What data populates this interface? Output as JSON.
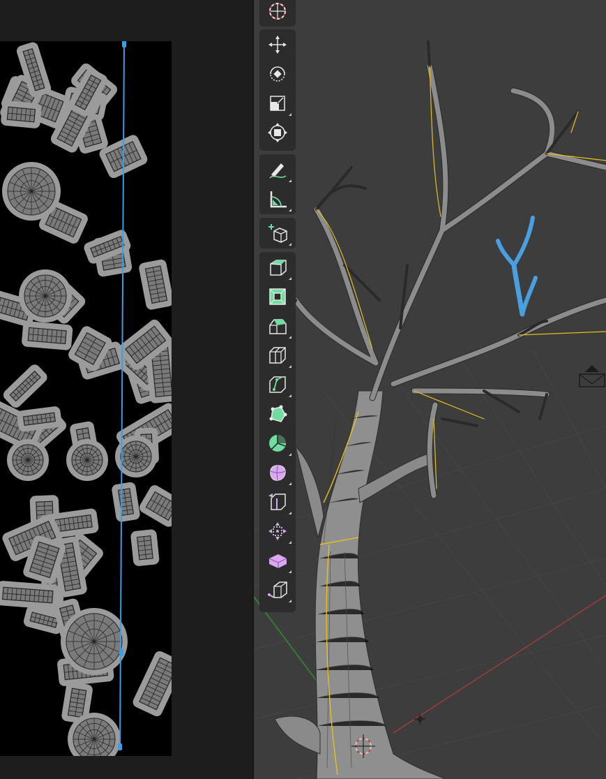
{
  "uv_editor": {
    "canvas_color": "#000000",
    "island_fill": "#7a7a7a",
    "island_edge": "#232323",
    "selected_edge_color": "#3a9ee6"
  },
  "viewport": {
    "background": "#3d3d3d",
    "mesh_color": "#8c8c8c",
    "seam_color": "#e6c11c",
    "selected_color": "#4a9fe0",
    "x_axis_color": "#b43c3c",
    "y_axis_color": "#2f8f2f"
  },
  "toolbar": {
    "groups": [
      {
        "tools": [
          {
            "icon": "cursor-icon"
          }
        ]
      },
      {
        "tools": [
          {
            "icon": "move-icon"
          },
          {
            "icon": "rotate-icon"
          },
          {
            "icon": "scale-icon"
          },
          {
            "icon": "transform-icon"
          }
        ]
      },
      {
        "tools": [
          {
            "icon": "annotate-icon"
          },
          {
            "icon": "measure-icon"
          }
        ]
      },
      {
        "tools": [
          {
            "icon": "add-cube-icon"
          }
        ]
      },
      {
        "tools": [
          {
            "icon": "extrude-region-icon"
          },
          {
            "icon": "inset-faces-icon"
          },
          {
            "icon": "bevel-icon"
          },
          {
            "icon": "loop-cut-icon"
          },
          {
            "icon": "knife-icon"
          },
          {
            "icon": "poly-build-icon"
          },
          {
            "icon": "spin-icon"
          },
          {
            "icon": "smooth-icon"
          },
          {
            "icon": "edge-slide-icon"
          },
          {
            "icon": "shrink-fatten-icon"
          },
          {
            "icon": "shear-icon"
          },
          {
            "icon": "rip-region-icon"
          }
        ]
      }
    ]
  }
}
